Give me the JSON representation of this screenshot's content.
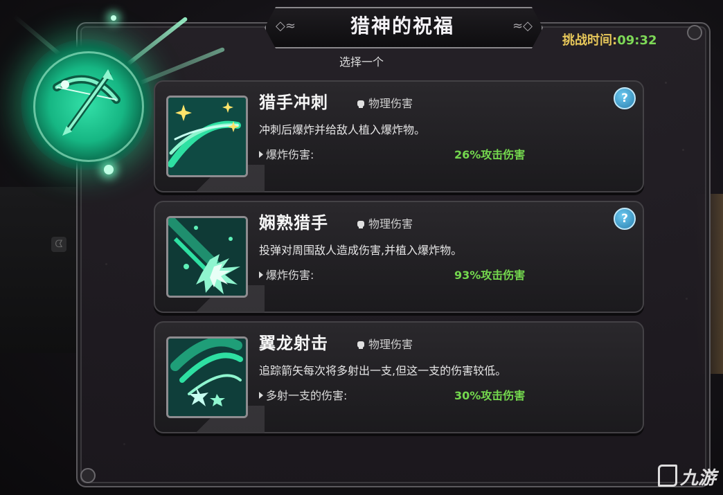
{
  "header": {
    "title": "猎神的祝福",
    "subtitle": "选择一个",
    "timer_label": "挑战时间:",
    "timer_value": "09:32"
  },
  "emblem": {
    "icon": "bow-arrow-icon"
  },
  "cards": [
    {
      "name": "猎手冲刺",
      "damage_type": "物理伤害",
      "description": "冲刺后爆炸并给敌人植入爆炸物。",
      "stat_label": "爆炸伤害:",
      "stat_value": "26%攻击伤害",
      "help": "?",
      "has_help": true,
      "icon": "dash-sparkle-icon"
    },
    {
      "name": "娴熟猎手",
      "damage_type": "物理伤害",
      "description": "投弹对周围敌人造成伤害,并植入爆炸物。",
      "stat_label": "爆炸伤害:",
      "stat_value": "93%攻击伤害",
      "help": "?",
      "has_help": true,
      "icon": "explosion-burst-icon"
    },
    {
      "name": "翼龙射击",
      "damage_type": "物理伤害",
      "description": "追踪箭矢每次将多射出一支,但这一支的伤害较低。",
      "stat_label": "多射一支的伤害:",
      "stat_value": "30%攻击伤害",
      "has_help": false,
      "icon": "homing-arrow-icon"
    }
  ],
  "watermark": "九游",
  "colors": {
    "accent_green": "#74d84e",
    "timer_gold": "#e8c85a",
    "emblem_teal": "#16b683",
    "help_blue": "#2a7fae"
  }
}
